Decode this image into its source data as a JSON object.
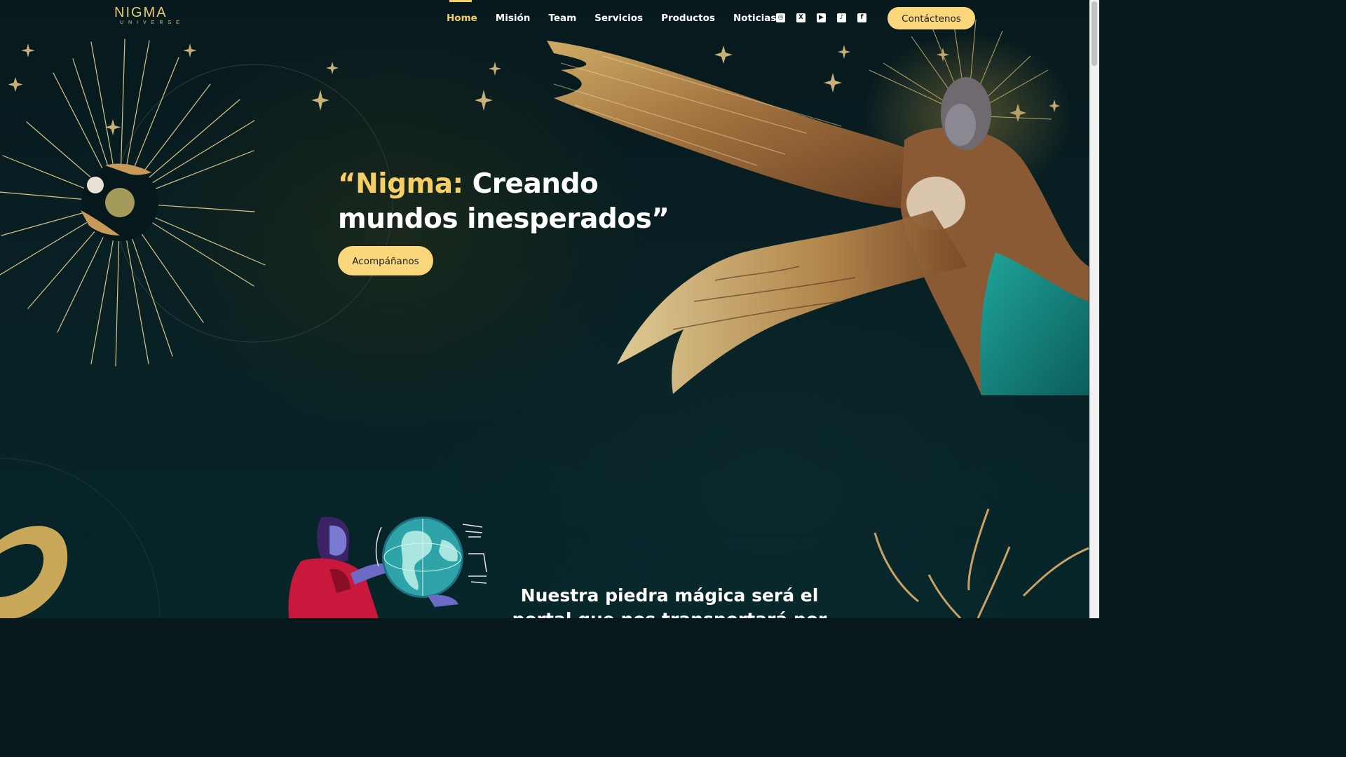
{
  "header": {
    "logo_text": "NIGMA",
    "logo_sub": "UNIVERSE",
    "nav": [
      {
        "label": "Home"
      },
      {
        "label": "Misión"
      },
      {
        "label": "Team"
      },
      {
        "label": "Servicios"
      },
      {
        "label": "Productos"
      },
      {
        "label": "Noticias"
      }
    ],
    "socials": [
      {
        "icon": "instagram-icon",
        "glyph": "◎"
      },
      {
        "icon": "x-twitter-icon",
        "glyph": "X"
      },
      {
        "icon": "youtube-icon",
        "glyph": "▶"
      },
      {
        "icon": "tiktok-icon",
        "glyph": "♪"
      },
      {
        "icon": "facebook-icon",
        "glyph": "f"
      }
    ],
    "cta_label": "Contáctenos"
  },
  "hero": {
    "title_accent": "“Nigma:",
    "title_rest": " Creando mundos inesperados”",
    "button_label": "Acompáñanos"
  },
  "section": {
    "title": "Nuestra piedra mágica será el portal que nos transportará por"
  },
  "colors": {
    "accent": "#f7ce65",
    "button": "#fbd77b",
    "background": "#07191d",
    "gold_art": "#d8b46a"
  }
}
